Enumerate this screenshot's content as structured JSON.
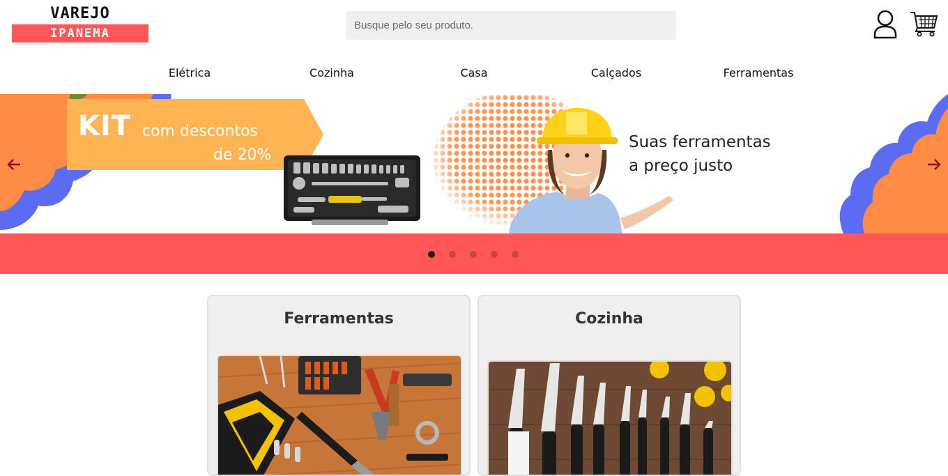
{
  "logo": {
    "top": "VAREJO",
    "bottom": "IPANEMA"
  },
  "search": {
    "placeholder": "Busque pelo seu produto."
  },
  "icons": {
    "user": "user-icon",
    "cart": "cart-icon",
    "prev": "arrow-left-icon",
    "next": "arrow-right-icon"
  },
  "nav": {
    "items": [
      "Elétrica",
      "Cozinha",
      "Casa",
      "Calçados",
      "Ferramentas"
    ]
  },
  "banner": {
    "promo_kit": "KIT",
    "promo_line1": "com descontos",
    "promo_line2": "de 20%",
    "tagline_line1": "Suas ferramentas",
    "tagline_line2": "a preço justo",
    "slide_count": 5,
    "active_slide": 1
  },
  "categories": [
    {
      "title": "Ferramentas"
    },
    {
      "title": "Cozinha"
    }
  ],
  "colors": {
    "brand_red": "#ff5757",
    "promo_orange": "#ffb453",
    "cloud_orange": "#ff8c45",
    "cloud_blue": "#5b6cf0"
  }
}
